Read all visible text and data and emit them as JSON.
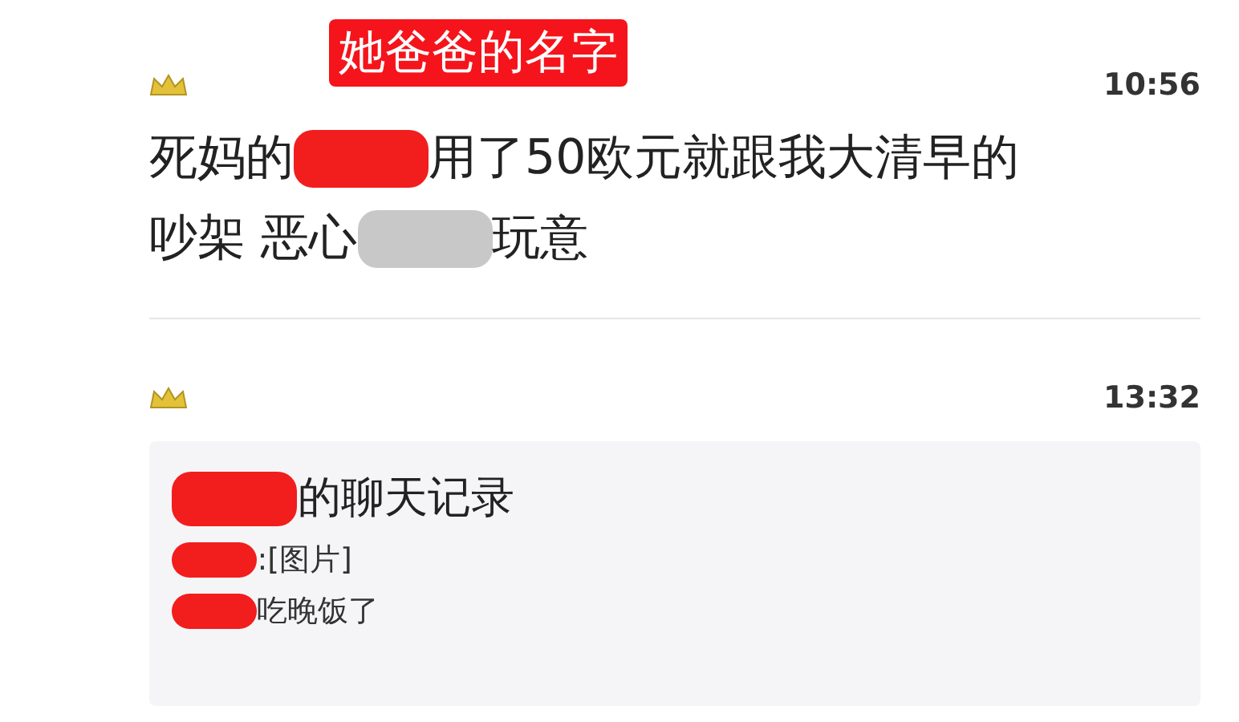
{
  "annotation": {
    "label": "她爸爸的名字"
  },
  "messages": [
    {
      "kind": "text",
      "time": "10:56",
      "lines": [
        [
          {
            "kind": "text",
            "text": "死妈的"
          },
          {
            "kind": "redaction",
            "color": "#f21d1d"
          },
          {
            "kind": "text",
            "text": "用了50欧元就跟我大清早的"
          }
        ],
        [
          {
            "kind": "text",
            "text": "吵架 恶心"
          },
          {
            "kind": "redaction",
            "color": "#c8c8c8"
          },
          {
            "kind": "text",
            "text": "玩意"
          }
        ]
      ]
    },
    {
      "kind": "forward",
      "time": "13:32",
      "title": [
        {
          "kind": "redaction",
          "color": "#f21d1d"
        },
        {
          "kind": "text",
          "text": "的聊天记录"
        }
      ],
      "lines": [
        [
          {
            "kind": "redaction",
            "color": "#f21d1d"
          },
          {
            "kind": "text",
            "text": ":[图片]"
          }
        ],
        [
          {
            "kind": "redaction",
            "color": "#f21d1d"
          },
          {
            "kind": "text",
            "text": "吃晚饭了"
          }
        ]
      ]
    }
  ]
}
